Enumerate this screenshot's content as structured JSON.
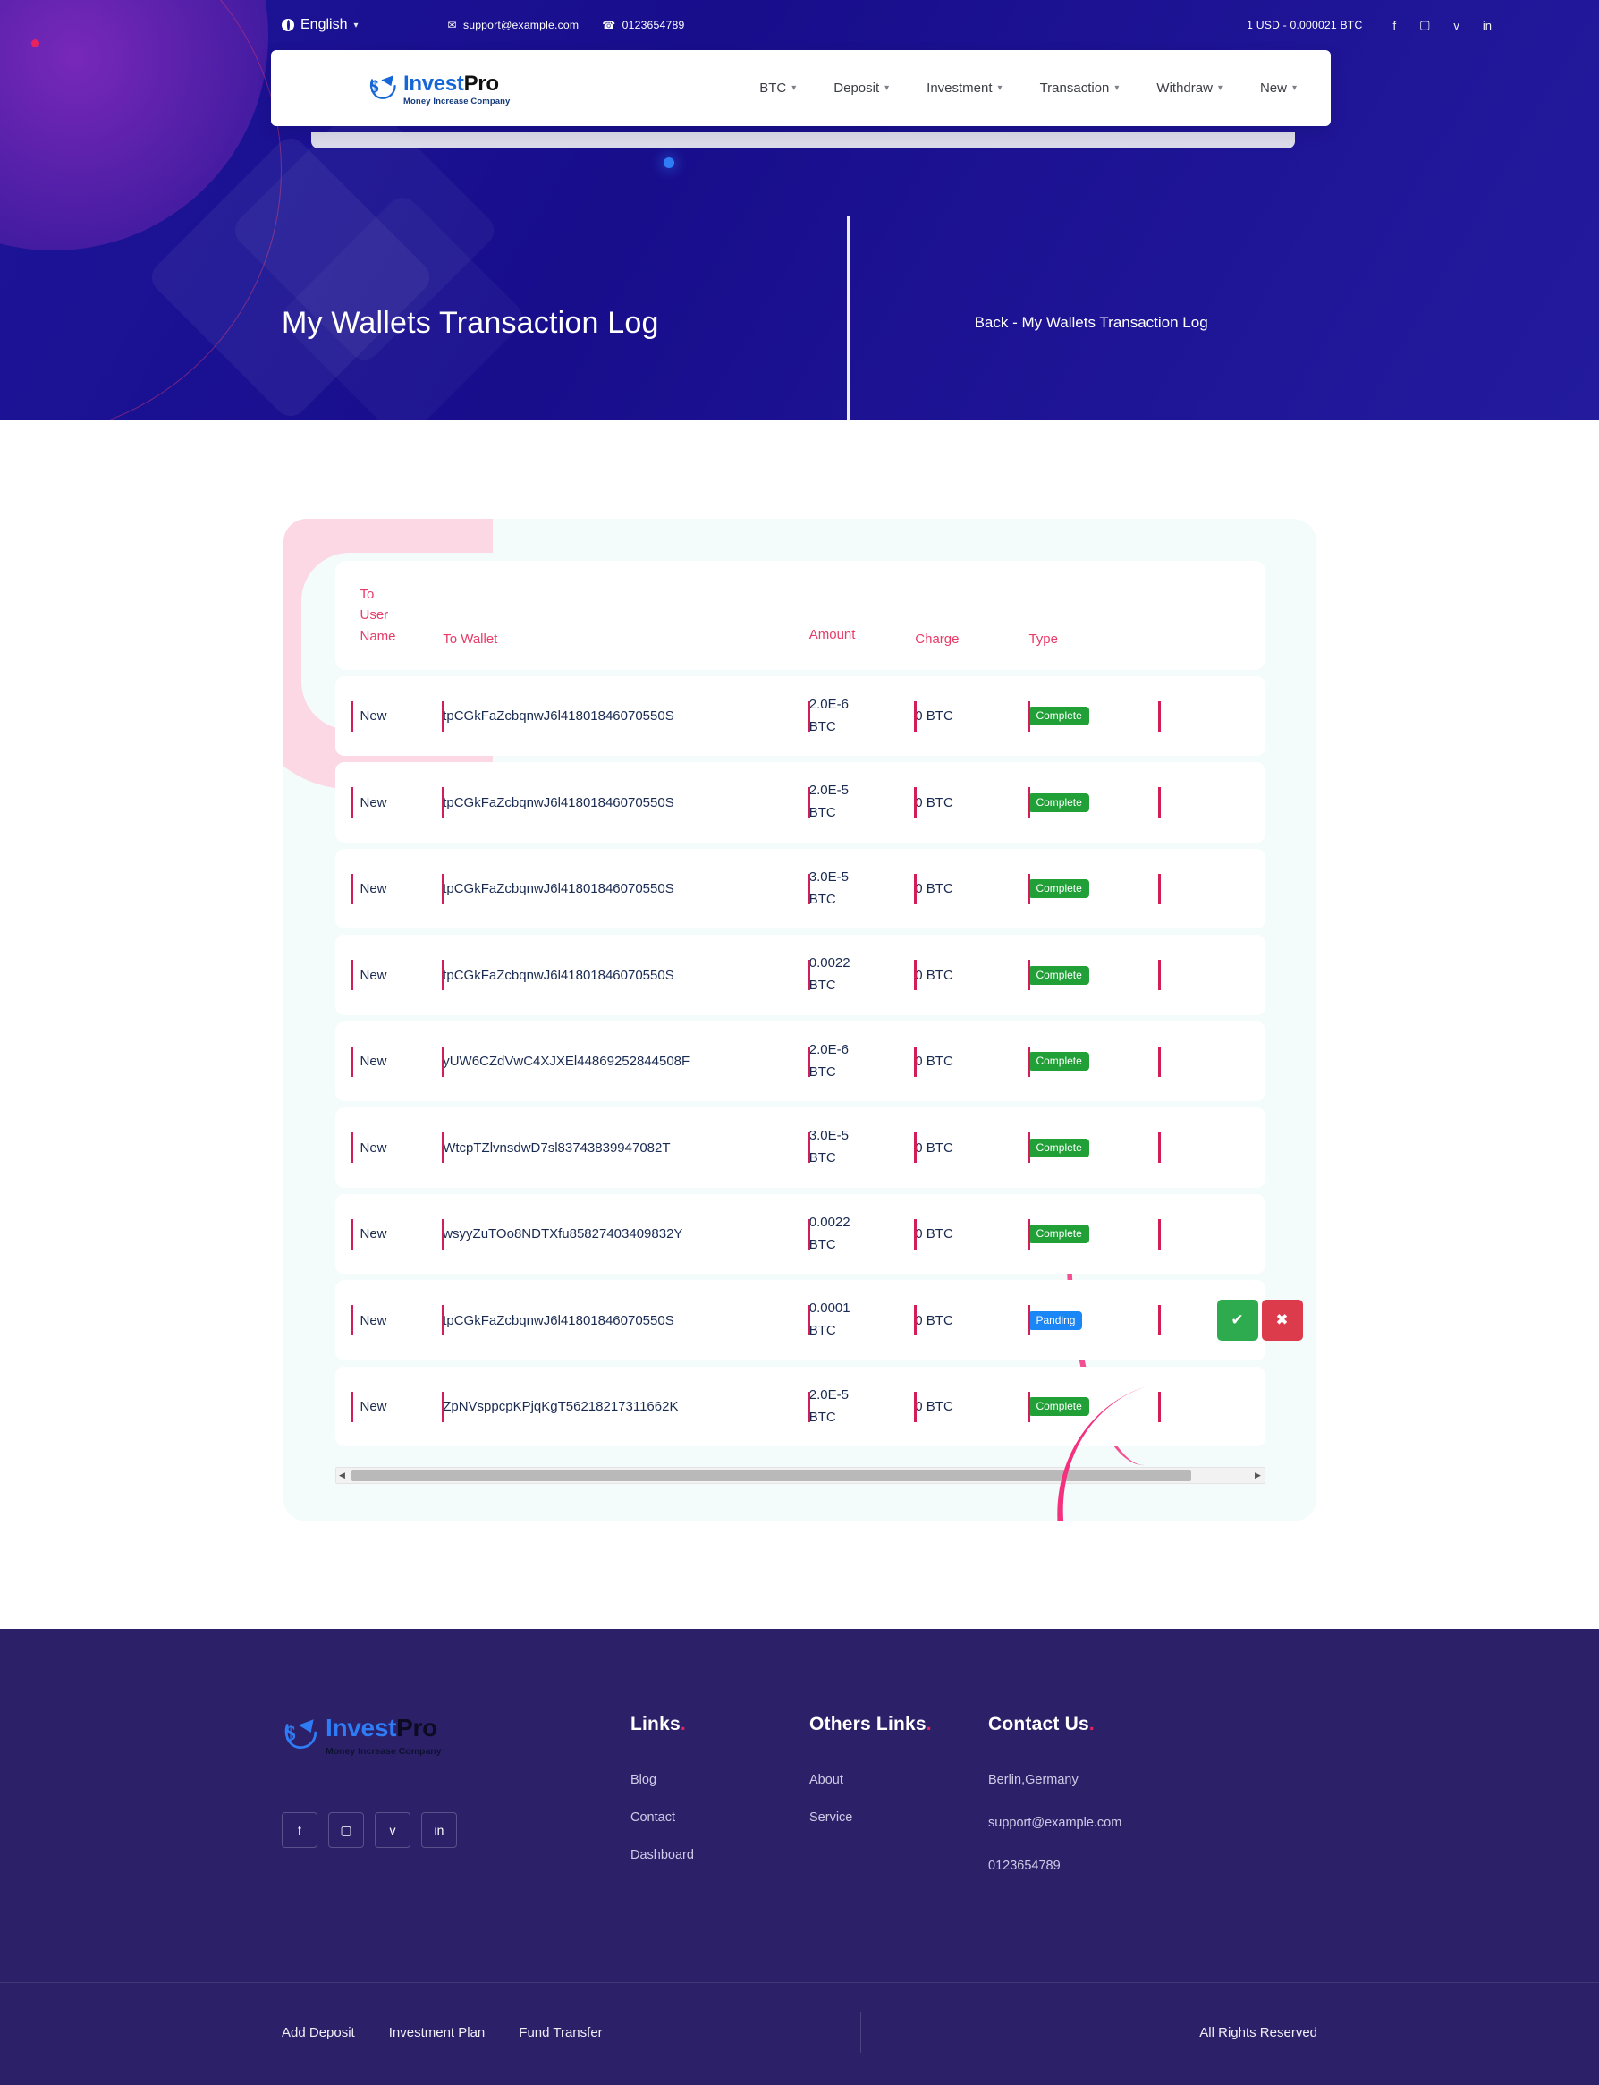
{
  "topbar": {
    "language": "English",
    "email": "support@example.com",
    "phone": "0123654789",
    "rate": "1 USD - 0.000021 BTC",
    "social": [
      {
        "name": "facebook-icon",
        "glyph": "f"
      },
      {
        "name": "instagram-icon",
        "glyph": "▢"
      },
      {
        "name": "twitter-icon",
        "glyph": "ᴠ"
      },
      {
        "name": "linkedin-icon",
        "glyph": "in"
      }
    ]
  },
  "brand": {
    "name_part1": "Invest",
    "name_part2": "Pro",
    "tagline": "Money Increase Company"
  },
  "nav": [
    {
      "label": "BTC"
    },
    {
      "label": "Deposit"
    },
    {
      "label": "Investment"
    },
    {
      "label": "Transaction"
    },
    {
      "label": "Withdraw"
    },
    {
      "label": "New"
    }
  ],
  "hero": {
    "title": "My Wallets Transaction Log",
    "breadcrumb_back": "Back",
    "breadcrumb_sep": "-",
    "breadcrumb_current": "My Wallets Transaction Log"
  },
  "table": {
    "headers": {
      "to_user_name": [
        "To",
        "User",
        "Name"
      ],
      "to_wallet": "To Wallet",
      "amount": "Amount",
      "charge": "Charge",
      "type": "Type",
      "action": ""
    },
    "rows": [
      {
        "name": "New",
        "wallet": "tpCGkFaZcbqnwJ6l41801846070550S",
        "amount": "2.0E-6",
        "amount_unit": "BTC",
        "charge": "0 BTC",
        "type": "Complete",
        "type_kind": "complete",
        "has_actions": false
      },
      {
        "name": "New",
        "wallet": "tpCGkFaZcbqnwJ6l41801846070550S",
        "amount": "2.0E-5",
        "amount_unit": "BTC",
        "charge": "0 BTC",
        "type": "Complete",
        "type_kind": "complete",
        "has_actions": false
      },
      {
        "name": "New",
        "wallet": "tpCGkFaZcbqnwJ6l41801846070550S",
        "amount": "3.0E-5",
        "amount_unit": "BTC",
        "charge": "0 BTC",
        "type": "Complete",
        "type_kind": "complete",
        "has_actions": false
      },
      {
        "name": "New",
        "wallet": "tpCGkFaZcbqnwJ6l41801846070550S",
        "amount": "0.0022",
        "amount_unit": "BTC",
        "charge": "0 BTC",
        "type": "Complete",
        "type_kind": "complete",
        "has_actions": false
      },
      {
        "name": "New",
        "wallet": "yUW6CZdVwC4XJXEl44869252844508F",
        "amount": "2.0E-6",
        "amount_unit": "BTC",
        "charge": "0 BTC",
        "type": "Complete",
        "type_kind": "complete",
        "has_actions": false
      },
      {
        "name": "New",
        "wallet": "WtcpTZlvnsdwD7sl83743839947082T",
        "amount": "3.0E-5",
        "amount_unit": "BTC",
        "charge": "0 BTC",
        "type": "Complete",
        "type_kind": "complete",
        "has_actions": false
      },
      {
        "name": "New",
        "wallet": "wsyyZuTOo8NDTXfu85827403409832Y",
        "amount": "0.0022",
        "amount_unit": "BTC",
        "charge": "0 BTC",
        "type": "Complete",
        "type_kind": "complete",
        "has_actions": false
      },
      {
        "name": "New",
        "wallet": "tpCGkFaZcbqnwJ6l41801846070550S",
        "amount": "0.0001",
        "amount_unit": "BTC",
        "charge": "0 BTC",
        "type": "Panding",
        "type_kind": "pending",
        "has_actions": true,
        "approve_glyph": "✔",
        "reject_glyph": "✖"
      },
      {
        "name": "New",
        "wallet": "ZpNVsppcpKPjqKgT56218217311662K",
        "amount": "2.0E-5",
        "amount_unit": "BTC",
        "charge": "0 BTC",
        "type": "Complete",
        "type_kind": "complete",
        "has_actions": false
      }
    ]
  },
  "footer": {
    "links": {
      "title": "Links",
      "items": [
        "Blog",
        "Contact",
        "Dashboard"
      ]
    },
    "others": {
      "title": "Others Links",
      "items": [
        "About",
        "Service"
      ]
    },
    "contact": {
      "title": "Contact Us",
      "address": "Berlin,Germany",
      "email": "support@example.com",
      "phone": "0123654789"
    },
    "bottom_links": [
      "Add Deposit",
      "Investment Plan",
      "Fund Transfer"
    ],
    "rights": "All Rights Reserved",
    "social": [
      {
        "name": "facebook-icon",
        "glyph": "f"
      },
      {
        "name": "instagram-icon",
        "glyph": "▢"
      },
      {
        "name": "twitter-icon",
        "glyph": "ᴠ"
      },
      {
        "name": "linkedin-icon",
        "glyph": "in"
      }
    ]
  },
  "colors": {
    "hero_bg": "#1d1499",
    "accent_pink": "#e83b67",
    "badge_complete": "#21a038",
    "badge_pending": "#1b86f5",
    "footer_bg": "#2c2069",
    "table_bg": "#f3fcfb"
  }
}
